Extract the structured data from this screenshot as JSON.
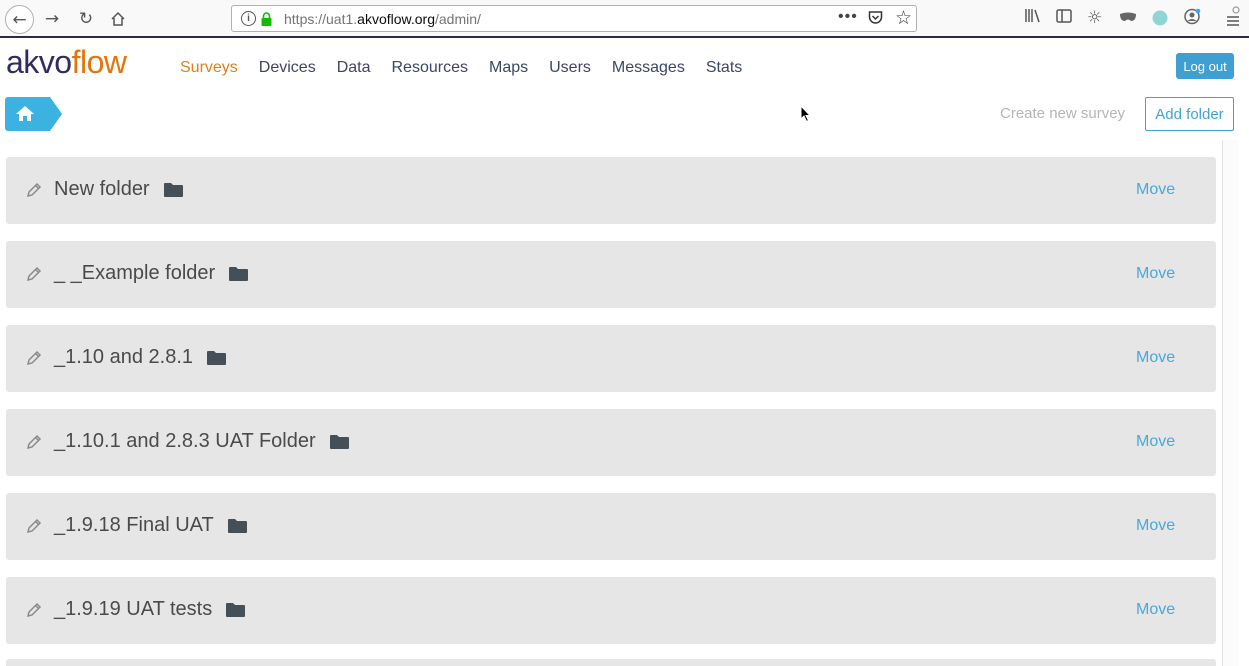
{
  "browser": {
    "url_prefix": "https://uat1.",
    "url_domain": "akvoflow.org",
    "url_path": "/admin/",
    "page_actions": "•••"
  },
  "app": {
    "logo_part1": "akvo",
    "logo_part2": "flow",
    "nav": [
      "Surveys",
      "Devices",
      "Data",
      "Resources",
      "Maps",
      "Users",
      "Messages",
      "Stats"
    ],
    "active_nav": "Surveys",
    "logout_label": "Log out"
  },
  "toolbar": {
    "create_survey_label": "Create new survey",
    "add_folder_label": "Add folder"
  },
  "folders": [
    {
      "name": "New folder",
      "action": "Move"
    },
    {
      "name": "_ _Example folder",
      "action": "Move"
    },
    {
      "name": "_1.10 and 2.8.1",
      "action": "Move"
    },
    {
      "name": "_1.10.1 and 2.8.3 UAT Folder",
      "action": "Move"
    },
    {
      "name": "_1.9.18 Final UAT",
      "action": "Move"
    },
    {
      "name": "_1.9.19 UAT tests",
      "action": "Move"
    }
  ],
  "colors": {
    "brand_dark": "#2d2e5f",
    "brand_orange": "#e4740c",
    "accent_blue": "#3d9fd2",
    "row_bg": "#e6e6e6"
  },
  "icons": [
    "back-icon",
    "forward-icon",
    "reload-icon",
    "home-icon",
    "info-icon",
    "lock-icon",
    "pocket-icon",
    "star-icon",
    "library-icon",
    "sidebar-icon",
    "settings-icon",
    "mask-icon",
    "avatar-icon",
    "account-icon",
    "menu-icon",
    "pencil-icon",
    "folder-icon"
  ]
}
